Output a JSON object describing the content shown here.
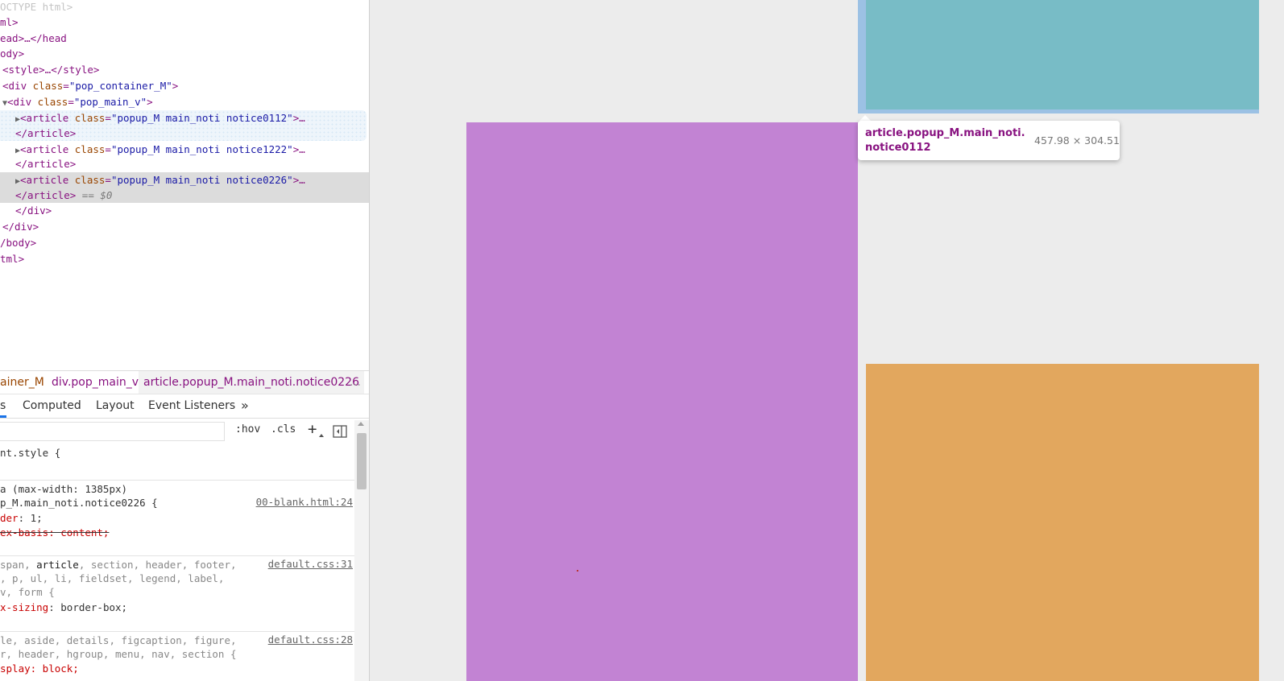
{
  "dom_tree": {
    "doctype": "OCTYPE html>",
    "html_open": "ml>",
    "head": "ead>…</head",
    "body_open": "ody>",
    "style": "<style>…</style>",
    "container_tag": "<div ",
    "container_attr": "class",
    "container_val": "\"pop_container_M\"",
    "main_tag": "<div ",
    "main_attr": "class",
    "main_val": "\"pop_main_v\"",
    "articles": [
      {
        "open": "<article ",
        "attr": "class",
        "val": "\"popup_M main_noti notice0112\"",
        "tail": ">…",
        "close": "</article>"
      },
      {
        "open": "<article ",
        "attr": "class",
        "val": "\"popup_M main_noti notice1222\"",
        "tail": ">…",
        "close": "</article>"
      },
      {
        "open": "<article ",
        "attr": "class",
        "val": "\"popup_M main_noti notice0226\"",
        "tail": ">…",
        "close": "</article>",
        "marker": "== $0"
      }
    ],
    "div_close_1": "</div>",
    "div_close_2": "</div>",
    "body_close": "/body>",
    "html_close": "tml>"
  },
  "breadcrumb": {
    "items": [
      "ainer_M",
      "div.pop_main_v",
      "article.popup_M.main_noti.notice0226"
    ],
    "more": "…"
  },
  "style_tabs": {
    "items": [
      "s",
      "Computed",
      "Layout",
      "Event Listeners"
    ],
    "more": "»"
  },
  "filter_bar": {
    "hov": ":hov",
    "cls": ".cls",
    "add": "+",
    "toggle_icon": "sidebar-toggle-icon"
  },
  "styles": {
    "element_style": "nt.style {",
    "media": "a (max-width: 1385px)",
    "rule1_selector": "p_M.main_noti.notice0226 {",
    "rule1_source": "00-blank.html:24",
    "rule1_prop1_name": "der",
    "rule1_prop1_value": ": 1;",
    "rule1_prop2": "ex-basis: content;",
    "rule2_selector_1a": "span, ",
    "rule2_selector_1b": "article",
    "rule2_selector_1c": ", section, header, footer,",
    "rule2_selector_2": ", p, ul, li, fieldset, legend, label,",
    "rule2_selector_3": "v, form {",
    "rule2_source": "default.css:31",
    "rule2_prop_name": "x-sizing",
    "rule2_prop_value": ": border-box;",
    "rule3_selector_1": "le, aside, details, figcaption, figure,",
    "rule3_selector_2": "r, header, hgroup, menu, nav, section {",
    "rule3_source": "default.css:28",
    "rule3_prop": "splay: block;"
  },
  "preview": {
    "colors": {
      "purple": "#c283d3",
      "teal": "#78bcc6",
      "teal_border": "#9cc1e4",
      "orange": "#e2a75e"
    }
  },
  "tooltip": {
    "name": "article.popup_M.main_noti.notice0112",
    "size": "457.98 × 304.51"
  }
}
